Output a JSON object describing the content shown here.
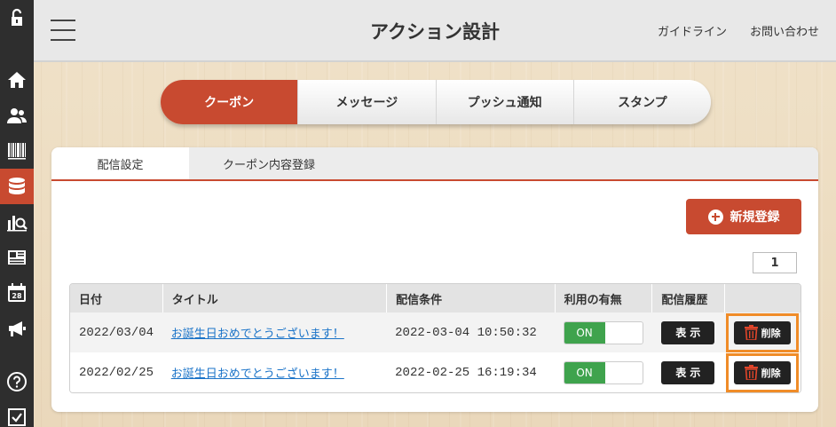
{
  "header": {
    "title": "アクション設計",
    "links": [
      "ガイドライン",
      "お問い合わせ"
    ]
  },
  "main_tabs": [
    {
      "label": "クーポン",
      "active": true
    },
    {
      "label": "メッセージ",
      "active": false
    },
    {
      "label": "プッシュ通知",
      "active": false
    },
    {
      "label": "スタンプ",
      "active": false
    }
  ],
  "sub_tabs": [
    {
      "label": "配信設定",
      "active": true
    },
    {
      "label": "クーポン内容登録",
      "active": false
    }
  ],
  "new_button_label": "新規登録",
  "page_number": "1",
  "table": {
    "columns": [
      "日付",
      "タイトル",
      "配信条件",
      "利用の有無",
      "配信履歴",
      ""
    ],
    "rows": [
      {
        "date": "2022/03/04",
        "title": "お誕生日おめでとうございます！",
        "condition": "2022-03-04 10:50:32",
        "usage": "ON",
        "history_label": "表 示",
        "delete_label": "削除"
      },
      {
        "date": "2022/02/25",
        "title": "お誕生日おめでとうございます！",
        "condition": "2022-02-25 16:19:34",
        "usage": "ON",
        "history_label": "表 示",
        "delete_label": "削除"
      }
    ]
  },
  "sidebar": {
    "icons": [
      "unlock-icon",
      "home-icon",
      "users-icon",
      "barcode-icon",
      "database-icon",
      "analytics-icon",
      "news-icon",
      "calendar-icon",
      "megaphone-icon",
      "help-icon",
      "checkbox-icon"
    ],
    "calendar_day": "28",
    "active_icon": "database-icon"
  },
  "colors": {
    "accent": "#c84a30",
    "toggle_on": "#3fa34d",
    "highlight": "#f08c28",
    "link": "#1a73c8",
    "sidebar": "#2e2e2e"
  }
}
